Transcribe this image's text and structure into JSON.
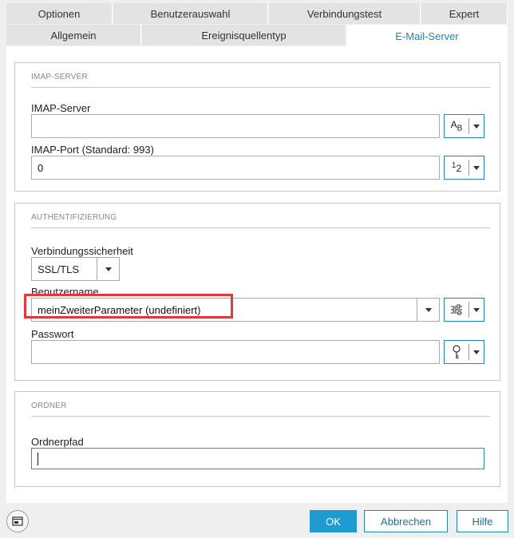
{
  "tabs_row1": [
    {
      "label": "Optionen"
    },
    {
      "label": "Benutzerauswahl"
    },
    {
      "label": "Verbindungstest"
    },
    {
      "label": "Expert"
    }
  ],
  "tabs_row2": [
    {
      "label": "Allgemein"
    },
    {
      "label": "Ereignisquellentyp"
    },
    {
      "label": "E-Mail-Server",
      "active": true
    }
  ],
  "imap": {
    "group_title": "IMAP-SERVER",
    "server_label": "IMAP-Server",
    "server_value": "",
    "server_button_icon": "text-type-icon",
    "server_button_glyph": "AB",
    "port_label": "IMAP-Port (Standard: 993)",
    "port_value": "0",
    "port_button_icon": "number-type-icon",
    "port_button_glyph": "12"
  },
  "auth": {
    "group_title": "AUTHENTIFIZIERUNG",
    "security_label": "Verbindungssicherheit",
    "security_value": "SSL/TLS",
    "username_label": "Benutzername",
    "username_value": "meinZweiterParameter (undefiniert)",
    "username_button_icon": "parameter-sliders-icon",
    "password_label": "Passwort",
    "password_value": "",
    "password_button_icon": "key-icon"
  },
  "folder": {
    "group_title": "ORDNER",
    "path_label": "Ordnerpfad",
    "path_value": ""
  },
  "footer": {
    "ok_label": "OK",
    "cancel_label": "Abbrechen",
    "help_label": "Hilfe",
    "window_icon": "window-switch-icon"
  },
  "colors": {
    "accent": "#1f9bd1",
    "active_tab_text": "#2a7fb8",
    "highlight_box": "#e0383e"
  }
}
